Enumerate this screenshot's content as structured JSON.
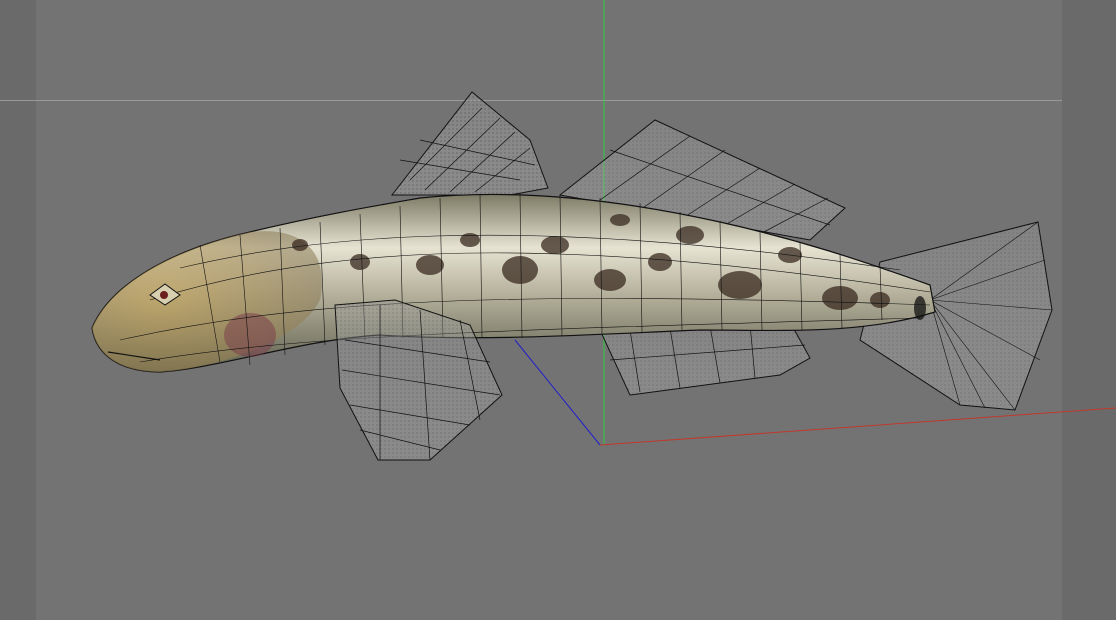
{
  "viewport": {
    "background": "#737373",
    "frame_shade": "#6a6a6a",
    "horizon_line_color": "#9a9a9a"
  },
  "axes": {
    "x_color": "#c0392b",
    "y_color": "#2ecc40",
    "z_color": "#2020c8"
  },
  "model": {
    "body_base": "#b8b29a",
    "body_highlight": "#e8e6d8",
    "spot_color": "#3a2a20",
    "head_tint": "#a8843c",
    "cheek_tint": "#7a3a4a",
    "wire_color": "#111111"
  }
}
